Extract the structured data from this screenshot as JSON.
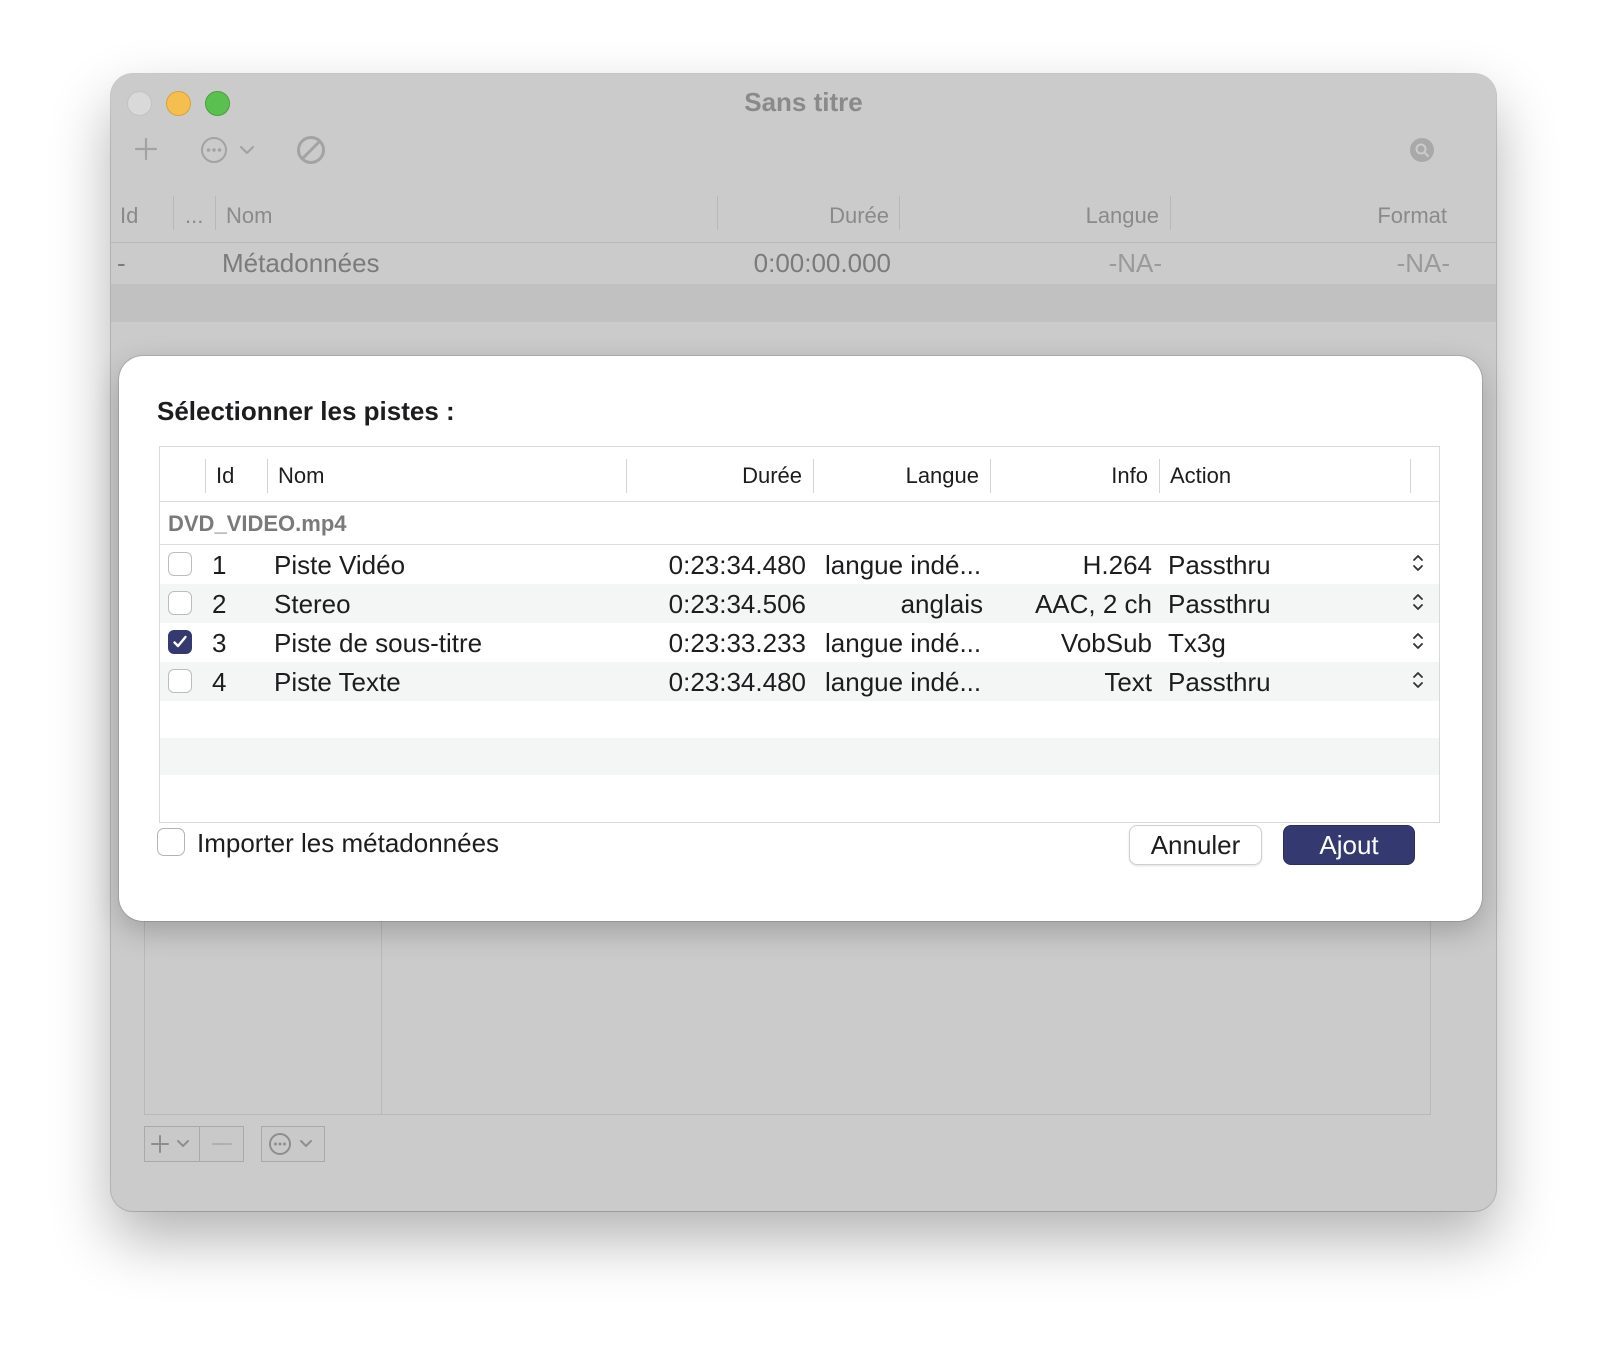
{
  "window": {
    "title": "Sans titre",
    "columns": [
      "Id",
      "...",
      "Nom",
      "Durée",
      "Langue",
      "Format"
    ],
    "metadata_row": {
      "id": "-",
      "name": "Métadonnées",
      "duration": "0:00:00.000",
      "language": "-NA-",
      "format": "-NA-"
    },
    "toolbar_icons": [
      "plus-icon",
      "ellipsis-circle-icon",
      "chevron-down-icon",
      "prohibit-icon",
      "search-icon"
    ],
    "bottom_icons": [
      "plus-icon",
      "minus-icon",
      "ellipsis-circle-icon"
    ]
  },
  "sheet": {
    "title": "Sélectionner les pistes :",
    "columns": {
      "id": "Id",
      "name": "Nom",
      "duration": "Durée",
      "language": "Langue",
      "info": "Info",
      "action": "Action"
    },
    "group": "DVD_VIDEO.mp4",
    "tracks": [
      {
        "checked": false,
        "id": "1",
        "name": "Piste Vidéo",
        "duration": "0:23:34.480",
        "language": "langue indé...",
        "info": "H.264",
        "action": "Passthru"
      },
      {
        "checked": false,
        "id": "2",
        "name": "Stereo",
        "duration": "0:23:34.506",
        "language": "anglais",
        "info": "AAC, 2 ch",
        "action": "Passthru"
      },
      {
        "checked": true,
        "id": "3",
        "name": "Piste de sous-titre",
        "duration": "0:23:33.233",
        "language": "langue indé...",
        "info": "VobSub",
        "action": "Tx3g"
      },
      {
        "checked": false,
        "id": "4",
        "name": "Piste Texte",
        "duration": "0:23:34.480",
        "language": "langue indé...",
        "info": "Text",
        "action": "Passthru"
      }
    ],
    "import_metadata_label": "Importer les métadonnées",
    "import_metadata_checked": false,
    "cancel_label": "Annuler",
    "add_label": "Ajout"
  },
  "colors": {
    "accent": "#343a70",
    "window_dimmed": "#cbcbcb",
    "close": "#d9d9d9",
    "minimize": "#f4bf4f",
    "maximize": "#5ac150"
  }
}
